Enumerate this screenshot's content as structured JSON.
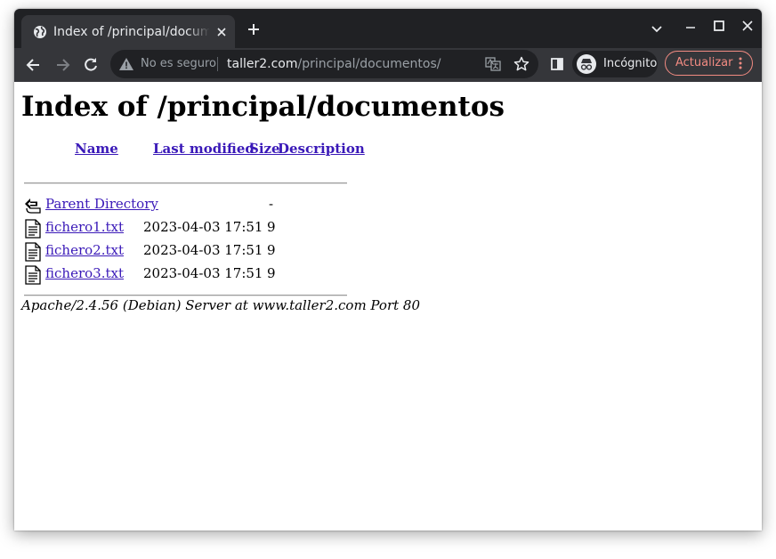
{
  "browser": {
    "tab": {
      "title": "Index of /principal/documentos"
    },
    "omnibox": {
      "security_text": "No es seguro",
      "url_host": "taller2.com",
      "url_path": "/principal/documentos/"
    },
    "incognito_label": "Incógnito",
    "update_label": "Actualizar",
    "colors": {
      "frame": "#202124",
      "toolbar": "#35363a",
      "update_accent": "#f28b82",
      "link": "#3a19b8"
    }
  },
  "page": {
    "heading": "Index of /principal/documentos",
    "columns": {
      "name": "Name",
      "last_modified": "Last modified",
      "size": "Size",
      "description": "Description"
    },
    "rows": [
      {
        "icon": "back-icon",
        "name": "Parent Directory",
        "modified": "",
        "size": "-"
      },
      {
        "icon": "text-file-icon",
        "name": "fichero1.txt",
        "modified": "2023-04-03 17:51",
        "size": "9"
      },
      {
        "icon": "text-file-icon",
        "name": "fichero2.txt",
        "modified": "2023-04-03 17:51",
        "size": "9"
      },
      {
        "icon": "text-file-icon",
        "name": "fichero3.txt",
        "modified": "2023-04-03 17:51",
        "size": "9"
      }
    ],
    "footer": "Apache/2.4.56 (Debian) Server at www.taller2.com Port 80"
  }
}
